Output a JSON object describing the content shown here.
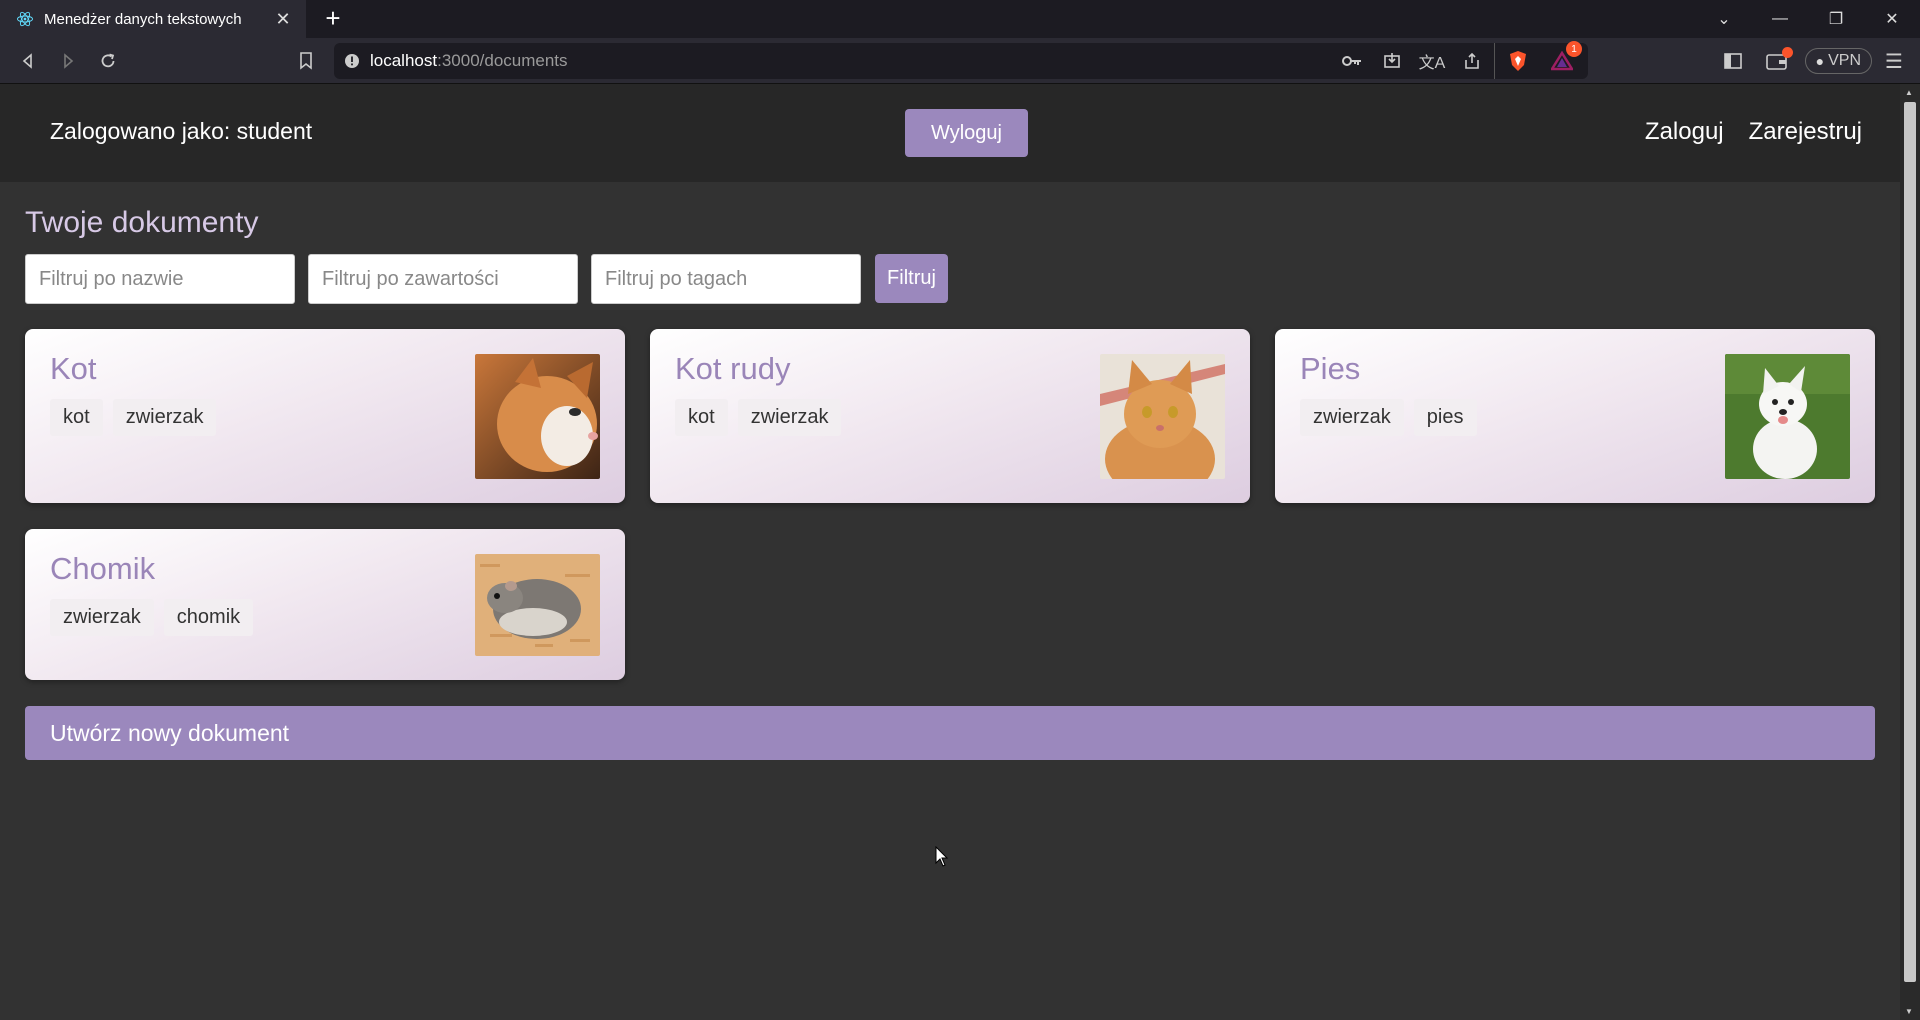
{
  "browser": {
    "tab_title": "Menedżer danych tekstowych",
    "url_host": "localhost",
    "url_path": ":3000/documents",
    "vpn_label": "VPN",
    "notification_count": "1"
  },
  "header": {
    "user_label": "Zalogowano jako: student",
    "logout_label": "Wyloguj",
    "nav": {
      "login": "Zaloguj",
      "register": "Zarejestruj"
    }
  },
  "main": {
    "title": "Twoje dokumenty",
    "filters": {
      "name_placeholder": "Filtruj po nazwie",
      "content_placeholder": "Filtruj po zawartości",
      "tags_placeholder": "Filtruj po tagach",
      "button_label": "Filtruj"
    },
    "documents": [
      {
        "title": "Kot",
        "tags": [
          "kot",
          "zwierzak"
        ],
        "image": "orange-white-cat"
      },
      {
        "title": "Kot rudy",
        "tags": [
          "kot",
          "zwierzak"
        ],
        "image": "ginger-cat"
      },
      {
        "title": "Pies",
        "tags": [
          "zwierzak",
          "pies"
        ],
        "image": "white-husky-puppy"
      },
      {
        "title": "Chomik",
        "tags": [
          "zwierzak",
          "chomik"
        ],
        "image": "grey-hamster"
      }
    ],
    "create_label": "Utwórz nowy dokument"
  },
  "colors": {
    "accent": "#9b88bd",
    "card_title": "#9a85b8",
    "header_bg": "#272727",
    "page_bg": "#323232"
  }
}
